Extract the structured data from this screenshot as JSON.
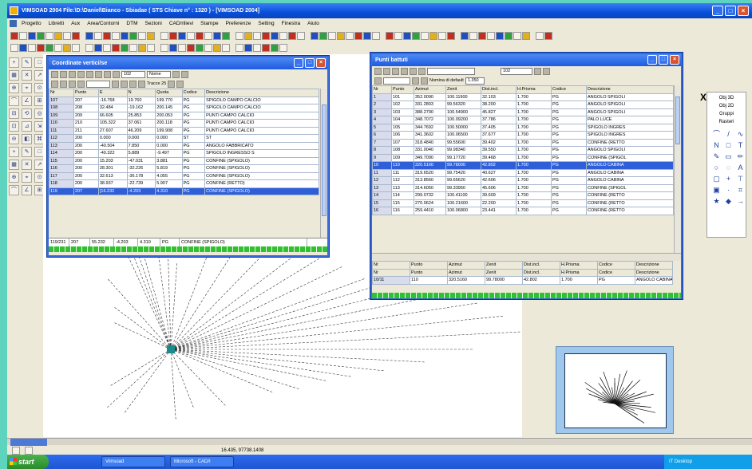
{
  "app": {
    "title": "VIMSOAD 2004 File:\\D:\\Daniel\\Bianco - Sbiadae ( STS Chiave n° : 1320 ) - [VIMSOAD 2004]",
    "menu": [
      "Progetto",
      "Libretti",
      "Aux",
      "Area/Contorni",
      "DTM",
      "Sezioni",
      "CAD/rilievi",
      "Stampe",
      "Preferenze",
      "Setting",
      "Finestra",
      "Aiuto"
    ],
    "zoom_combo": "Standard",
    "close_x": "X",
    "status_text": "16.435, 97738.1408",
    "colors": {
      "accent": "#2e5fd8",
      "titlebar": "#0a4fd8",
      "desktop": "#5ed3bd"
    }
  },
  "right_panel": {
    "labels": [
      "Obj 3D",
      "Obj 2D",
      "Gruppi",
      "Rasteri"
    ],
    "icons": [
      "curve-icon",
      "line-icon",
      "wave-icon",
      "letter-n-icon",
      "square-icon",
      "text-icon",
      "pen-icon",
      "frame-icon",
      "pencil-icon",
      "circle-icon",
      "ring-icon",
      "letter-a-icon",
      "box-icon",
      "cross-icon",
      "tee-icon",
      "square2-icon",
      "dot-icon",
      "grid-icon",
      "star-icon",
      "diamond-icon",
      "arrow-icon"
    ]
  },
  "coord_window": {
    "title": "Coordinate vertici/se",
    "combo_value": "102",
    "combo_name": "Nome",
    "filter_label": "Tracce 25",
    "columns": [
      "Nr",
      "Punto",
      "E",
      "N",
      "Quota",
      "Codice",
      "Descrizione"
    ],
    "rows": [
      [
        "107",
        "207",
        "-16.768",
        "19.760",
        "199.770",
        "PG",
        "SPIGOLO CAMPO CALCIO"
      ],
      [
        "108",
        "208",
        "32.484",
        "-19.162",
        "200.145",
        "PG",
        "SPIGOLO CAMPO CALCIO"
      ],
      [
        "109",
        "209",
        "66.605",
        "25.853",
        "200.053",
        "PG",
        "PUNTI CAMPO CALCIO"
      ],
      [
        "110",
        "210",
        "105.322",
        "37.061",
        "200.118",
        "PG",
        "PUNTI CAMPO CALCIO"
      ],
      [
        "111",
        "211",
        "27.607",
        "46.209",
        "199.908",
        "PG",
        "PUNTI CAMPO CALCIO"
      ],
      [
        "112",
        "200",
        "0.000",
        "0.000",
        "0.000",
        "ST",
        "ST"
      ],
      [
        "113",
        "200",
        "-40.504",
        "7.850",
        "0.000",
        "PG",
        "ANGOLO FABBRICATO"
      ],
      [
        "114",
        "200",
        "-40.322",
        "5.889",
        "-9.497",
        "PG",
        "SPIGOLO INGRESSO S"
      ],
      [
        "115",
        "200",
        "15.203",
        "-47.031",
        "3.881",
        "PG",
        "CONFINE (SPIGOLO)"
      ],
      [
        "116",
        "200",
        "28.301",
        "-32.226",
        "5.819",
        "PG",
        "CONFINE (SPIGOLO)"
      ],
      [
        "117",
        "200",
        "32.613",
        "-36.178",
        "4.055",
        "PG",
        "CONFINE (SPIGOLO)"
      ],
      [
        "118",
        "200",
        "38.937",
        "-22.739",
        "5.907",
        "PG",
        "CONFINE (RETTO)"
      ],
      [
        "119",
        "207",
        "[16.232",
        "-4.203",
        "4.310",
        "PG",
        "CONFINE (SPIGOLO)"
      ]
    ],
    "edit_row": [
      "119/231",
      "207",
      "55.232",
      "-4.203",
      "4.310",
      "PG",
      "CONFINE (SPIGOLO)"
    ]
  },
  "points_window": {
    "title": "Punti battuti",
    "combo_value": "102",
    "defaults_label": "Nomina di default",
    "defaults_value": "1.350",
    "columns": [
      "Nr",
      "Punto",
      "Azimut",
      "Zenit",
      "Dist.incl.",
      "H.Prisma",
      "Codice",
      "Descrizione"
    ],
    "rows": [
      [
        "1",
        "101",
        "352.0090",
        "100.11900",
        "32.103",
        "1.700",
        "PG",
        "ANGOLO SPIGOLI"
      ],
      [
        "2",
        "102",
        "331.2803",
        "99.56320",
        "38.200",
        "1.700",
        "PG",
        "ANGOLO SPIGOLI"
      ],
      [
        "3",
        "103",
        "388.2790",
        "100.54900",
        "45.827",
        "1.700",
        "PG",
        "ANGOLO SPIGOLI"
      ],
      [
        "4",
        "104",
        "348.7072",
        "100.09200",
        "37.786",
        "1.700",
        "PG",
        "PALO LUCE"
      ],
      [
        "5",
        "105",
        "344.7692",
        "100.50000",
        "37.405",
        "1.700",
        "PG",
        "SPIGOLO INGRES"
      ],
      [
        "6",
        "106",
        "341.3602",
        "100.06500",
        "37.677",
        "1.700",
        "PG",
        "SPIGOLO INGRES"
      ],
      [
        "7",
        "107",
        "318.4840",
        "99.55600",
        "39.402",
        "1.700",
        "PG",
        "CONFINE (RETTO"
      ],
      [
        "8",
        "108",
        "331.0040",
        "99.98340",
        "39.550",
        "1.700",
        "PG",
        "ANGOLO SPIGOLI"
      ],
      [
        "9",
        "109",
        "349.7090",
        "99.17720",
        "39.468",
        "1.700",
        "PG",
        "CONFINE (SPIGOL"
      ],
      [
        "10",
        "110",
        "320.5160",
        "99.78000",
        "42.802",
        "1.700",
        "PG",
        "ANGOLO CABINA"
      ],
      [
        "11",
        "111",
        "319.6520",
        "99.75420",
        "40.627",
        "1.700",
        "PG",
        "ANGOLO CABINA"
      ],
      [
        "12",
        "112",
        "313.8560",
        "99.65620",
        "42.606",
        "1.700",
        "PG",
        "ANGOLO CABINA"
      ],
      [
        "13",
        "113",
        "314.6050",
        "99.33950",
        "45.606",
        "1.700",
        "PG",
        "CONFINE (SPIGOL"
      ],
      [
        "14",
        "114",
        "299.0732",
        "100.41100",
        "39.609",
        "1.700",
        "PG",
        "CONFINE (RETTO"
      ],
      [
        "15",
        "115",
        "270.0624",
        "100.21600",
        "22.200",
        "1.700",
        "PG",
        "CONFINE (RETTO"
      ],
      [
        "16",
        "116",
        "259.4410",
        "100.06800",
        "23.441",
        "1.700",
        "PG",
        "CONFINE (RETTO"
      ]
    ],
    "selected_row": 9,
    "edit_row": [
      "10/11",
      "110",
      "320.5160",
      "99.78000",
      "42.802",
      "1.700",
      "PG",
      "ANGOLO CABINA"
    ]
  },
  "taskbar": {
    "start": "start",
    "tasks": [
      "Vimsoad",
      "Microsoft - CAD/I"
    ],
    "tray": "IT  Desktop"
  }
}
